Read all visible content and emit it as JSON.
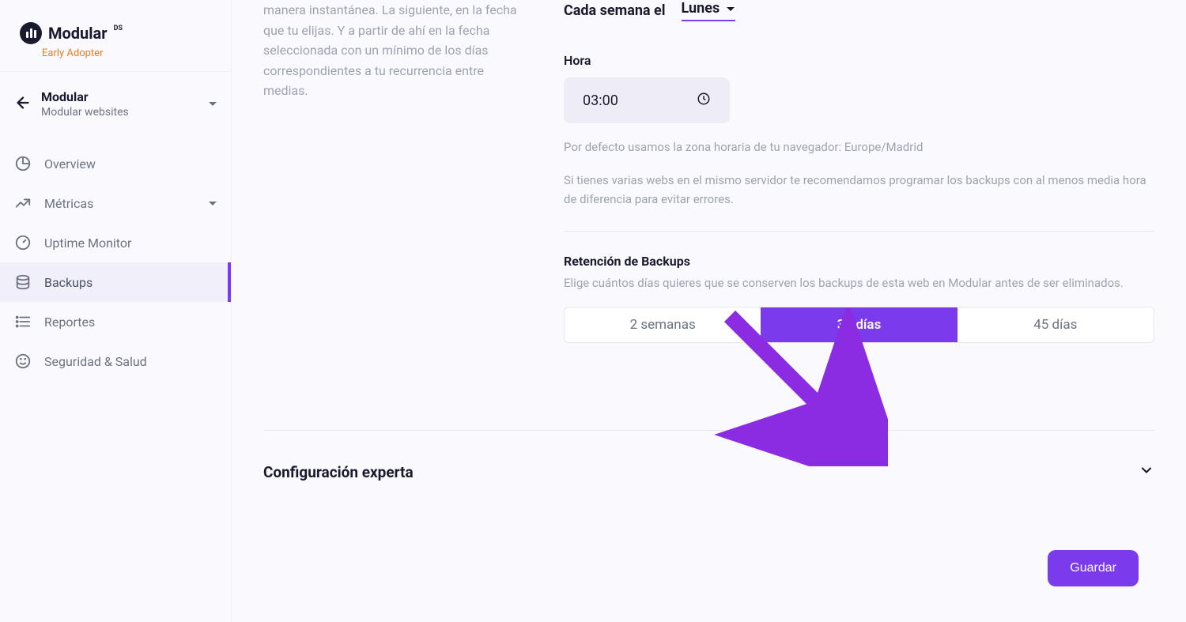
{
  "brand": {
    "name": "Modular",
    "suffix": "DS",
    "tag": "Early Adopter"
  },
  "org": {
    "title": "Modular",
    "subtitle": "Modular websites"
  },
  "nav": {
    "overview": "Overview",
    "metrics": "Métricas",
    "uptime": "Uptime Monitor",
    "backups": "Backups",
    "reports": "Reportes",
    "security": "Seguridad & Salud"
  },
  "description": "manera instantánea. La siguiente, en la fecha que tu elijas. Y a partir de ahí en la fecha seleccionada con un mínimo de los días correspondientes a tu recurrencia entre medias.",
  "schedule": {
    "label": "Cada semana el",
    "day": "Lunes"
  },
  "hour": {
    "label": "Hora",
    "value": "03:00",
    "tz_text": "Por defecto usamos la zona horaria de tu navegador: Europe/Madrid",
    "tip_text": "Si tienes varias webs en el mismo servidor te recomendamos programar los backups con al menos media hora de diferencia para evitar errores."
  },
  "retention": {
    "title": "Retención de Backups",
    "desc": "Elige cuántos días quieres que se conserven los backups de esta web en Modular antes de ser eliminados.",
    "options": [
      "2 semanas",
      "30 días",
      "45 días"
    ],
    "selected_index": 1
  },
  "expert": {
    "title": "Configuración experta"
  },
  "save_button": "Guardar"
}
